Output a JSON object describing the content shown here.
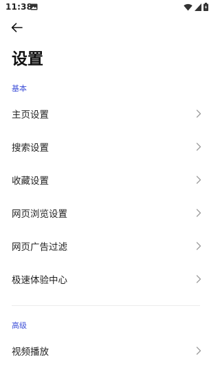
{
  "status_bar": {
    "time": "11:38",
    "icons": [
      "gallery-icon",
      "wifi-icon",
      "signal-icon",
      "battery-icon"
    ]
  },
  "header": {
    "back_icon": "arrow-left-icon",
    "title": "设置"
  },
  "sections": [
    {
      "header": "基本",
      "items": [
        {
          "label": "主页设置"
        },
        {
          "label": "搜索设置"
        },
        {
          "label": "收藏设置"
        },
        {
          "label": "网页浏览设置"
        },
        {
          "label": "网页广告过滤"
        },
        {
          "label": "极速体验中心"
        }
      ]
    },
    {
      "header": "高级",
      "items": [
        {
          "label": "视频播放"
        }
      ]
    }
  ],
  "colors": {
    "accent": "#3f51d8",
    "text": "#222222",
    "chevron": "#9e9e9e",
    "divider": "#ececec"
  }
}
